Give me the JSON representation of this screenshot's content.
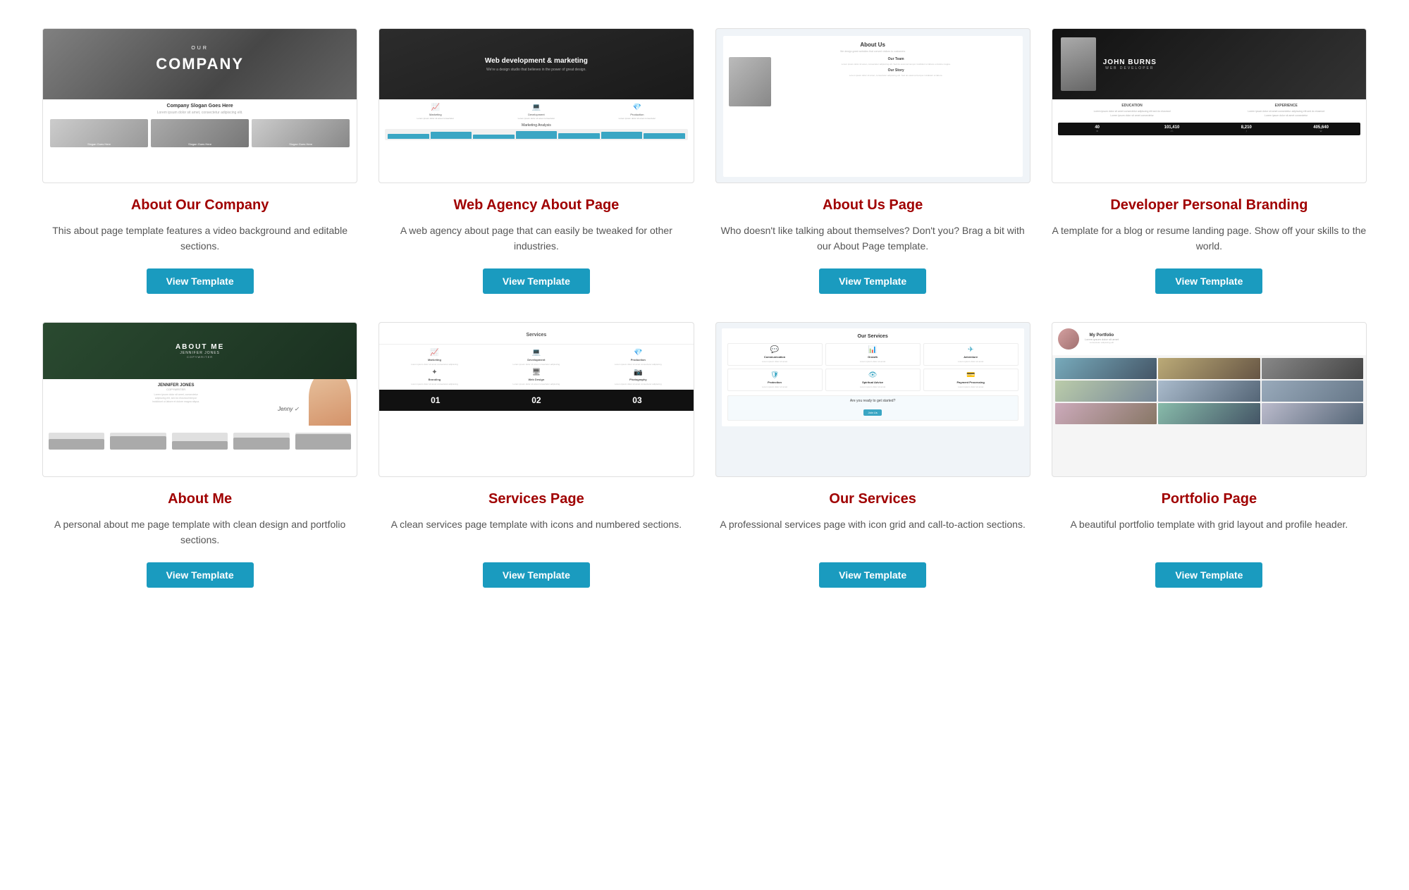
{
  "cards": [
    {
      "id": "about-our-company",
      "title": "About Our Company",
      "description": "This about page template features a video background and editable sections.",
      "button_label": "View Template",
      "thumb_type": "company"
    },
    {
      "id": "web-agency-about-page",
      "title": "Web Agency About Page",
      "description": "A web agency about page that can easily be tweaked for other industries.",
      "button_label": "View Template",
      "thumb_type": "agency"
    },
    {
      "id": "about-us-page",
      "title": "About Us Page",
      "description": "Who doesn't like talking about themselves? Don't you? Brag a bit with our About Page template.",
      "button_label": "View Template",
      "thumb_type": "about"
    },
    {
      "id": "developer-personal-branding",
      "title": "Developer Personal Branding",
      "description": "A template for a blog or resume landing page. Show off your skills to the world.",
      "button_label": "View Template",
      "thumb_type": "dev"
    },
    {
      "id": "about-me",
      "title": "About Me",
      "description": "A personal about me page template with clean design and portfolio sections.",
      "button_label": "View Template",
      "thumb_type": "aboutme"
    },
    {
      "id": "services-page",
      "title": "Services Page",
      "description": "A clean services page template with icons and numbered sections.",
      "button_label": "View Template",
      "thumb_type": "services"
    },
    {
      "id": "our-services",
      "title": "Our Services",
      "description": "A professional services page with icon grid and call-to-action sections.",
      "button_label": "View Template",
      "thumb_type": "ourservices"
    },
    {
      "id": "portfolio-page",
      "title": "Portfolio Page",
      "description": "A beautiful portfolio template with grid layout and profile header.",
      "button_label": "View Template",
      "thumb_type": "portfolio"
    }
  ],
  "thumbnails": {
    "company": {
      "hero_label": "OUR",
      "company_name": "COMPANY",
      "slogan": "Company Slogan Goes Here",
      "slogan_sub": "Lorem ipsum dolor sit amet, consectetur adipiscing elit.",
      "col1_label": "Slogan Goes Here",
      "col2_label": "Slogan Goes Here",
      "col3_label": "Slogan Goes Here"
    },
    "agency": {
      "hero_title": "Web development & marketing",
      "hero_sub": "We're a design studio that believes in the power of great design.",
      "svc1": "Marketing",
      "svc2": "Development",
      "svc3": "Production",
      "analysis_label": "Marketing Analysis"
    },
    "about": {
      "page_title": "About Us",
      "team_title": "Our Team",
      "story_title": "Our Story"
    },
    "dev": {
      "hero_name": "JOHN BURNS",
      "hero_role": "WEB DEVELOPER",
      "col1_title": "EDUCATION",
      "col2_title": "EXPERIENCE",
      "stat1": "40",
      "stat2": "101,410",
      "stat3": "8,210",
      "stat4": "405,640"
    }
  }
}
